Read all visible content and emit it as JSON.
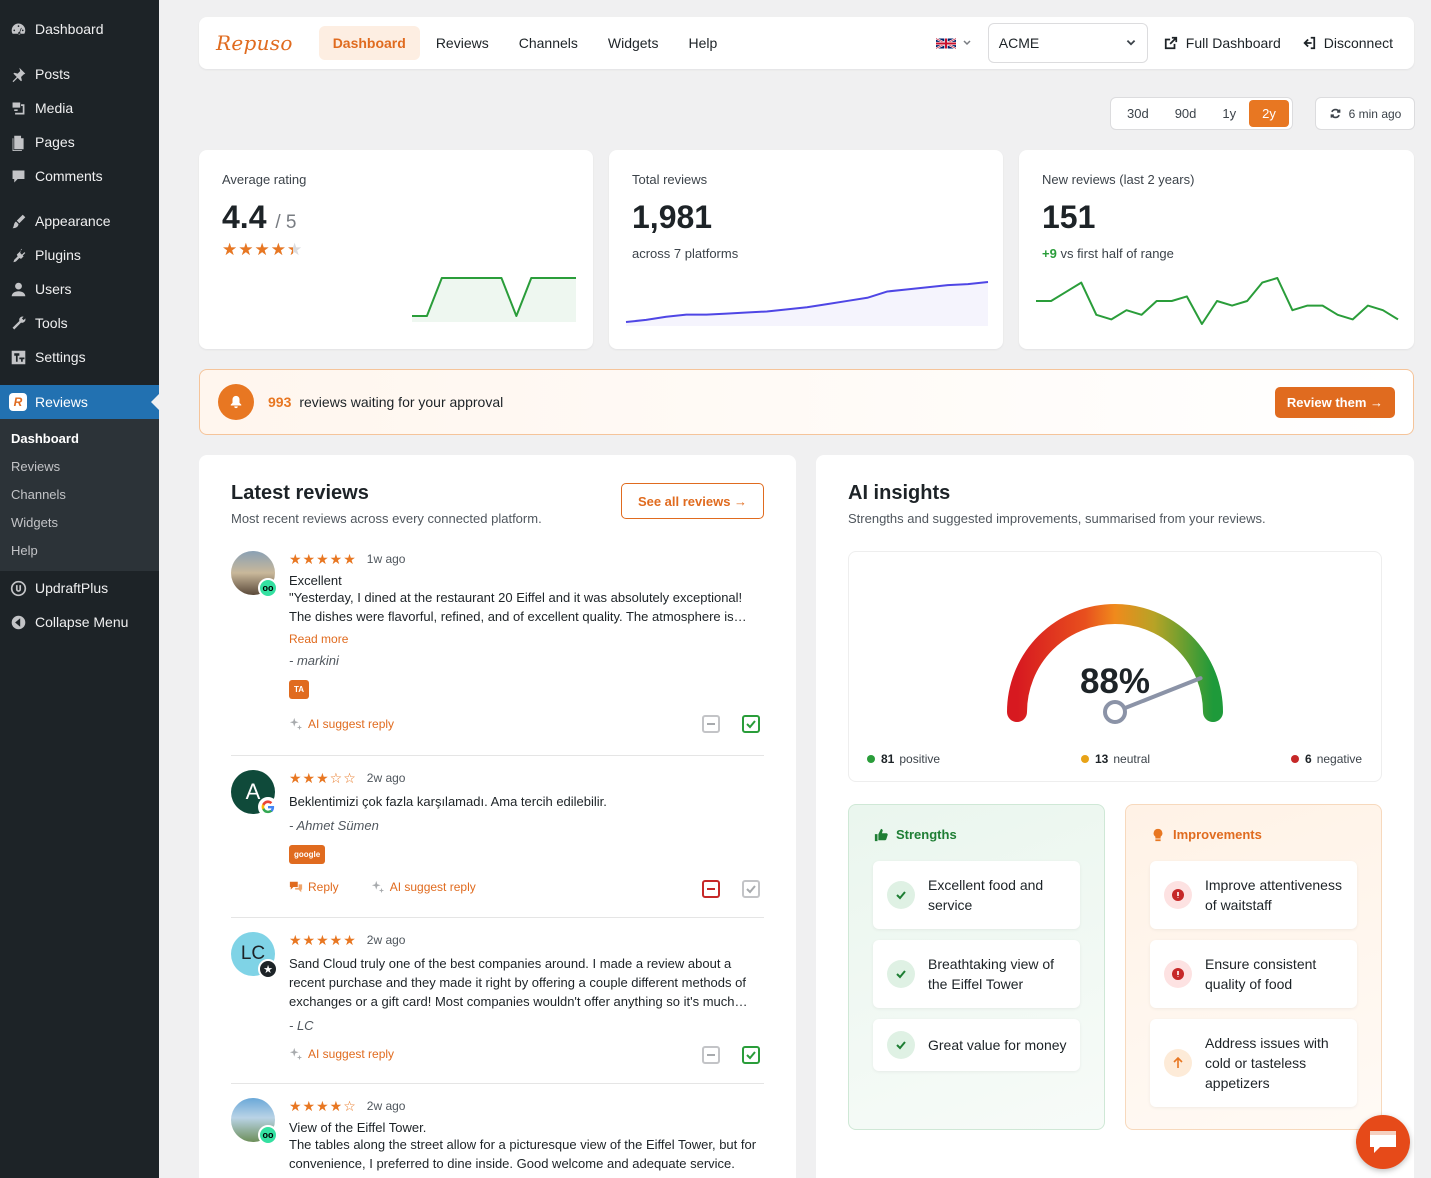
{
  "wp_menu": {
    "dashboard": "Dashboard",
    "posts": "Posts",
    "media": "Media",
    "pages": "Pages",
    "comments": "Comments",
    "appearance": "Appearance",
    "plugins": "Plugins",
    "users": "Users",
    "tools": "Tools",
    "settings": "Settings",
    "reviews": "Reviews",
    "submenu": [
      "Dashboard",
      "Reviews",
      "Channels",
      "Widgets",
      "Help"
    ],
    "updraft": "UpdraftPlus",
    "collapse": "Collapse Menu"
  },
  "topnav": {
    "logo": "Repuso",
    "tabs": [
      "Dashboard",
      "Reviews",
      "Channels",
      "Widgets",
      "Help"
    ],
    "account": "ACME",
    "full_dashboard": "Full Dashboard",
    "disconnect": "Disconnect"
  },
  "range": {
    "options": [
      "30d",
      "90d",
      "1y",
      "2y"
    ],
    "selected": "2y",
    "refreshed": "6 min ago"
  },
  "stats": {
    "avg": {
      "label": "Average rating",
      "value": "4.4",
      "suffix": "/ 5",
      "stars": "★★★★★",
      "rating": 4.4
    },
    "total": {
      "label": "Total reviews",
      "value": "1,981",
      "sub": "across 7 platforms"
    },
    "new": {
      "label": "New reviews (last 2 years)",
      "value": "151",
      "delta": "+9",
      "sub": "vs first half of range"
    }
  },
  "sparklines": {
    "avg": [
      1,
      1,
      5,
      5,
      5,
      5,
      5,
      1,
      5,
      5,
      5,
      5
    ],
    "total": [
      2,
      4,
      7,
      9,
      9,
      10,
      11,
      12,
      14,
      16,
      19,
      22,
      25,
      31,
      33,
      35,
      37,
      38,
      40
    ],
    "new": [
      10,
      10,
      12,
      14,
      7,
      6,
      8,
      7,
      10,
      10,
      11,
      5,
      10,
      9,
      10,
      14,
      15,
      8,
      9,
      9,
      7,
      6,
      9,
      8,
      6
    ]
  },
  "approval": {
    "count": "993",
    "message": "reviews waiting for your approval",
    "button": "Review them →"
  },
  "latest": {
    "title": "Latest reviews",
    "subtitle": "Most recent reviews across every connected platform.",
    "see_all": "See all reviews →",
    "more": "Read more",
    "ai_reply": "AI suggest reply",
    "reply": "Reply",
    "items": [
      {
        "stars": "★★★★★",
        "when": "1w ago",
        "title": "Excellent",
        "text": "\"Yesterday, I dined at the restaurant 20 Eiffel and it was absolutely exceptional! The dishes were flavorful, refined, and of excellent quality. The atmosphere is…",
        "author": "- markini",
        "source": "TA"
      },
      {
        "stars": "★★★☆☆",
        "when": "2w ago",
        "text": "Beklentimizi çok fazla karşılamadı. Ama tercih edilebilir.",
        "author": "- Ahmet Sümen",
        "source": "google",
        "initial": "A"
      },
      {
        "stars": "★★★★★",
        "when": "2w ago",
        "text": "Sand Cloud truly one of the best companies around. I made a review about a recent purchase and they made it right by offering a couple different methods of exchanges or a gift card! Most companies wouldn't offer anything so it's much…",
        "author": "- LC",
        "initial": "LC"
      },
      {
        "stars": "★★★★☆",
        "when": "2w ago",
        "title": "View of the Eiffel Tower.",
        "text": "The tables along the street allow for a picturesque view of the Eiffel Tower, but for convenience, I preferred to dine inside. Good welcome and adequate service. T…"
      }
    ]
  },
  "ai": {
    "title": "AI insights",
    "subtitle": "Strengths and suggested improvements, summarised from your reviews.",
    "gauge_label": "88%",
    "gauge_value": 0.88,
    "positive": {
      "count": "81",
      "label": "positive"
    },
    "neutral": {
      "count": "13",
      "label": "neutral"
    },
    "negative": {
      "count": "6",
      "label": "negative"
    },
    "strengths_title": "Strengths",
    "strengths": [
      "Excellent food and service",
      "Breathtaking view of the Eiffel Tower",
      "Great value for money"
    ],
    "improvements_title": "Improvements",
    "improvements": [
      "Improve attentiveness of waitstaff",
      "Ensure consistent quality of food",
      "Address issues with cold or tasteless appetizers"
    ]
  },
  "colors": {
    "brand": "#e06b1f",
    "wp_active": "#2271b1",
    "positive": "#2a9d3a",
    "neutral": "#e8a317",
    "negative": "#c62828",
    "chart_total": "#4f46e5"
  }
}
